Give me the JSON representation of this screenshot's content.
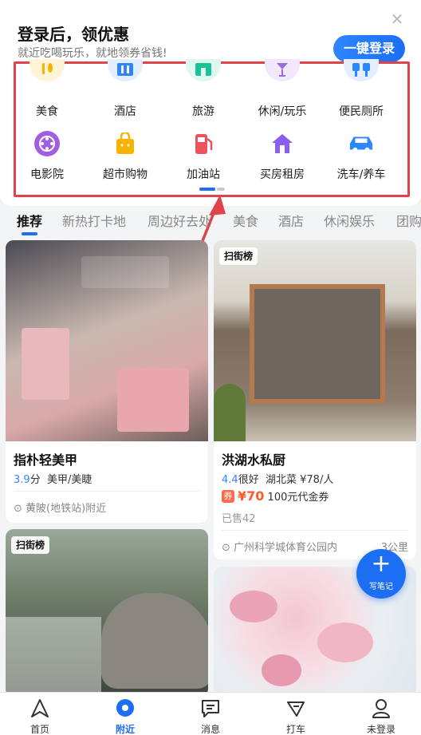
{
  "login_banner": {
    "title": "登录后，领优惠",
    "subtitle": "就近吃喝玩乐，就地领券省钱!",
    "login_button": "一键登录"
  },
  "categories": [
    {
      "label": "美食",
      "icon": "food-icon",
      "color": "#f6b400"
    },
    {
      "label": "酒店",
      "icon": "hotel-icon",
      "color": "#2e86ff"
    },
    {
      "label": "旅游",
      "icon": "travel-icon",
      "color": "#19c39a"
    },
    {
      "label": "休闲/玩乐",
      "icon": "leisure-icon",
      "color": "#9b6bd9"
    },
    {
      "label": "便民厕所",
      "icon": "toilet-icon",
      "color": "#2e86ff"
    },
    {
      "label": "电影院",
      "icon": "cinema-icon",
      "color": "#a25ee0"
    },
    {
      "label": "超市购物",
      "icon": "shopping-bag-icon",
      "color": "#f6b400"
    },
    {
      "label": "加油站",
      "icon": "gas-station-icon",
      "color": "#f0525d"
    },
    {
      "label": "买房租房",
      "icon": "house-icon",
      "color": "#8a5ef0"
    },
    {
      "label": "洗车/养车",
      "icon": "car-icon",
      "color": "#2e86ff"
    }
  ],
  "tabs": [
    "推荐",
    "新热打卡地",
    "周边好去处",
    "美食",
    "酒店",
    "休闲娱乐",
    "团购"
  ],
  "cards": [
    {
      "title": "指朴轻美甲",
      "score": "3.9",
      "unit": "分",
      "category": "美甲/美睫",
      "location": "黄陂(地铁站)附近"
    },
    {
      "badge": "扫街榜",
      "title": "洪湖水私厨",
      "score": "4.4",
      "rating_text": "很好",
      "cuisine": "湖北菜",
      "per_person": "¥78/人",
      "coupon_tag": "券",
      "coupon_price": "¥70",
      "coupon_desc": "100元代金券",
      "sold": "已售42",
      "location": "广州科学城体育公园内",
      "distance": "3公里"
    },
    {
      "badge": "扫街榜"
    }
  ],
  "fab": {
    "label": "写笔记"
  },
  "bottom_nav": [
    {
      "label": "首页",
      "icon": "home-navigation-icon"
    },
    {
      "label": "附近",
      "icon": "nearby-location-icon"
    },
    {
      "label": "消息",
      "icon": "message-icon"
    },
    {
      "label": "打车",
      "icon": "taxi-icon"
    },
    {
      "label": "未登录",
      "icon": "user-icon"
    }
  ],
  "colors": {
    "accent": "#1c6ef2",
    "highlight_border": "#e0434b",
    "price": "#ff5a2a"
  }
}
